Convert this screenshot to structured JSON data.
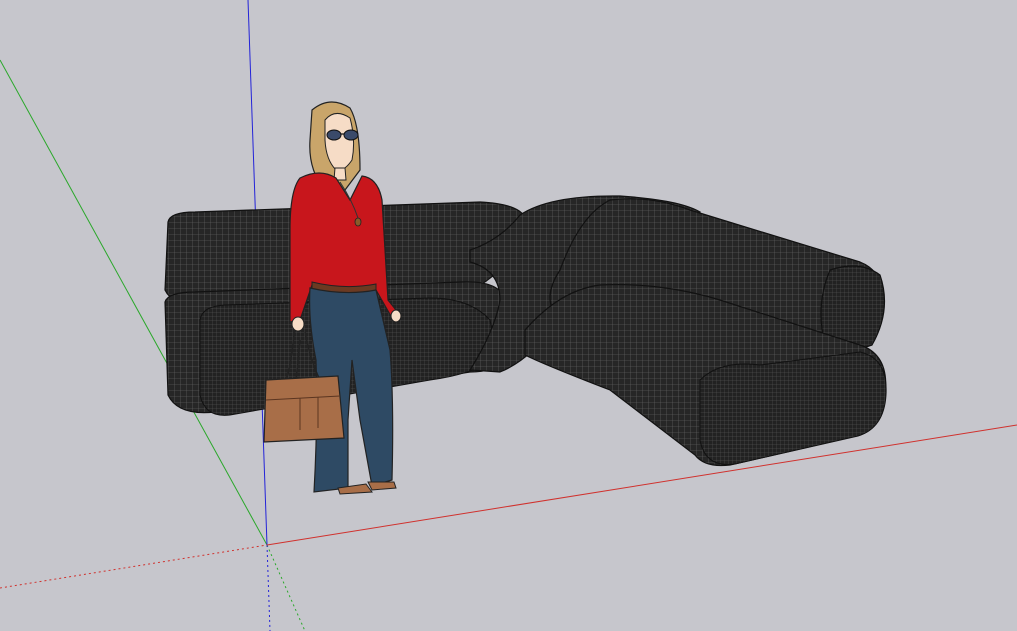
{
  "viewport": {
    "background": "#c6c6cc",
    "axis_colors": {
      "red": "#d0312d",
      "green": "#2aa82a",
      "blue": "#2323d8"
    }
  },
  "model": {
    "objects": [
      {
        "name": "sectional-sofa",
        "color": "#2a2a2a",
        "wire_color": "#6a6a6a"
      },
      {
        "name": "scale-figure",
        "top_color": "#c8161c",
        "pants_color": "#2e4a64",
        "hair_color": "#c9a56a",
        "bag_color": "#a86e48"
      }
    ]
  }
}
